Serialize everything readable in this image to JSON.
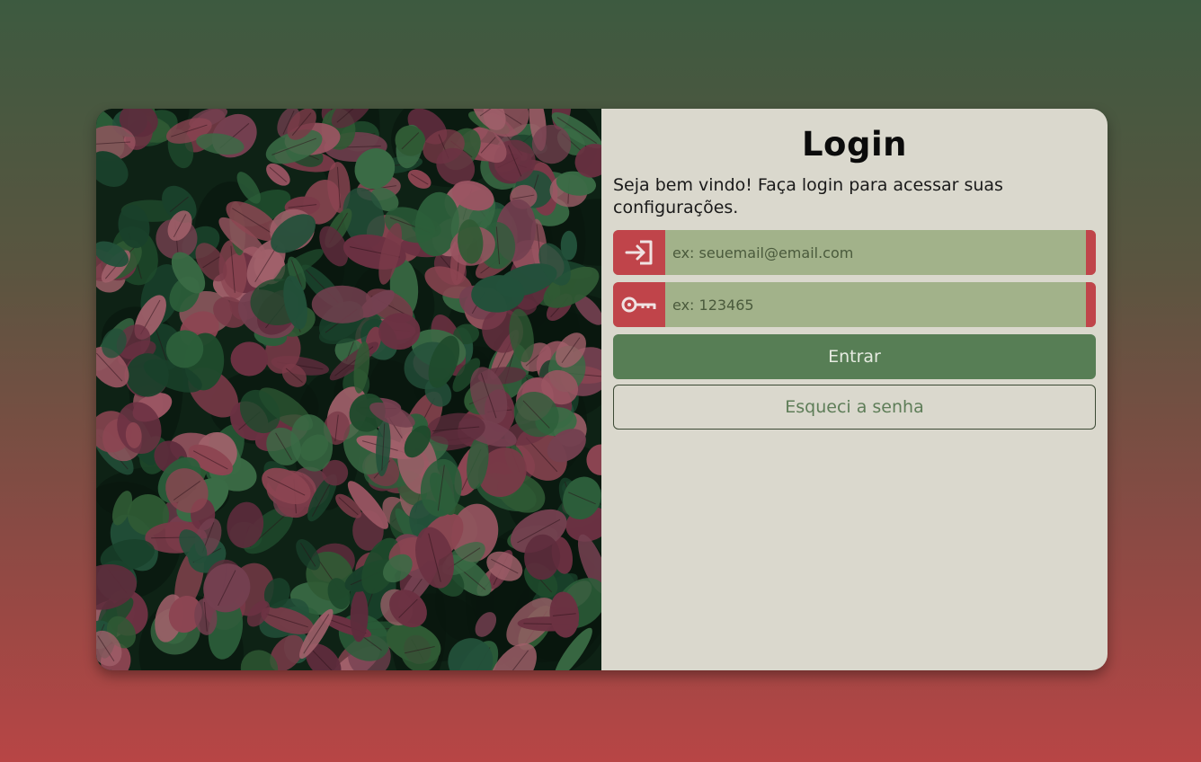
{
  "login": {
    "title": "Login",
    "subtitle": "Seja bem vindo! Faça login para acessar suas configurações.",
    "email_placeholder": "ex: seuemail@email.com",
    "email_icon": "login-arrow-icon",
    "password_placeholder": "ex: 123465",
    "password_icon": "key-icon",
    "submit_label": "Entrar",
    "forgot_label": "Esqueci a senha"
  },
  "colors": {
    "accent_red": "#c0444a",
    "input_green": "#a2b28a",
    "button_green": "#577e55",
    "panel_bg": "#dad8cd"
  }
}
